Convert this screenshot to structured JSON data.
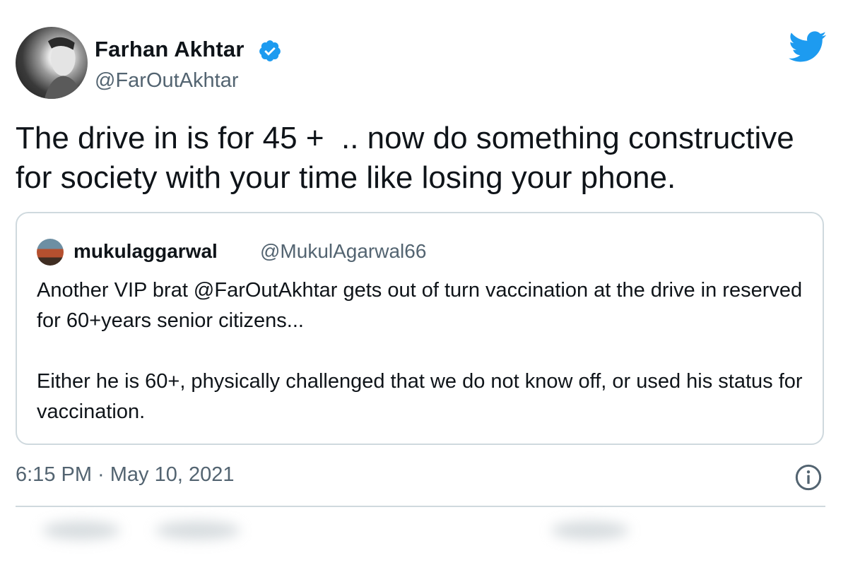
{
  "tweet": {
    "author": {
      "name": "Farhan Akhtar",
      "handle": "@FarOutAkhtar",
      "verified": true
    },
    "text": "The drive in is for 45 +  .. now do something constructive for society with your time like losing your phone.",
    "timestamp": "6:15 PM · May 10, 2021"
  },
  "quoted_tweet": {
    "author": {
      "name": "mukulaggarwal",
      "handle": "@MukulAgarwal66"
    },
    "paragraphs": [
      "Another VIP brat @FarOutAkhtar gets out of turn vaccination at the drive in reserved for 60+years senior citizens...",
      "Either he is 60+, physically challenged that we do not know off, or used his status for vaccination."
    ]
  },
  "icons": {
    "brand": "twitter-bird-icon",
    "verified": "verified-badge-icon",
    "info": "info-icon"
  },
  "colors": {
    "brand_blue": "#1d9bf0",
    "secondary_text": "#536471",
    "primary_text": "#0f1419",
    "border": "#cfd9de"
  }
}
